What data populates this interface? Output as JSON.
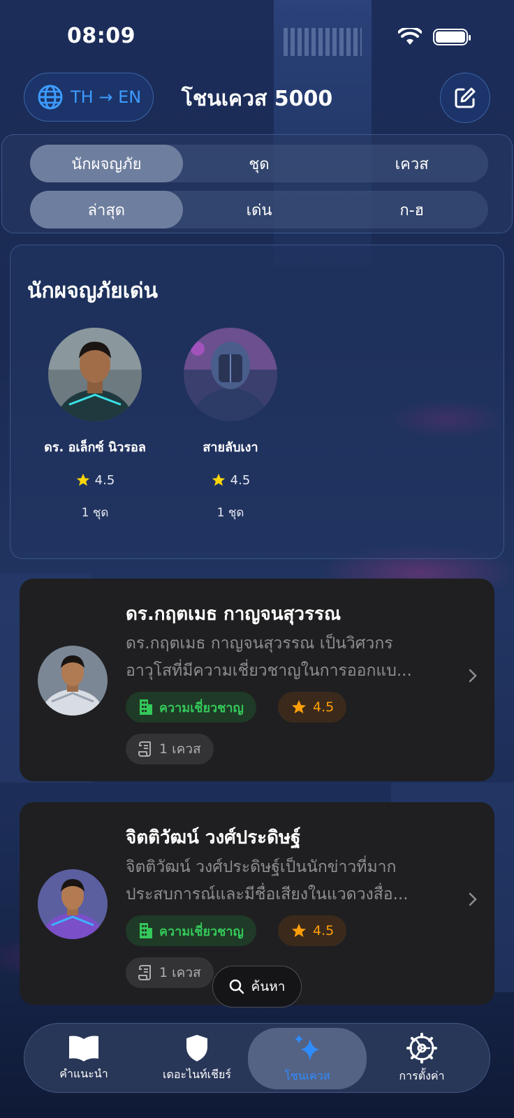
{
  "status_bar": {
    "time": "08:09"
  },
  "header": {
    "lang_label": "TH → EN",
    "title": "โชนเควส 5000"
  },
  "filters": {
    "row1": [
      "นักผจญภัย",
      "ชุด",
      "เควส"
    ],
    "row1_active": 0,
    "row2": [
      "ล่าสุด",
      "เด่น",
      "ก-ฮ"
    ],
    "row2_active": 0
  },
  "featured": {
    "title": "นักผจญภัยเด่น",
    "items": [
      {
        "name": "ดร. อเล็กซ์ นิวรอล",
        "rating": "4.5",
        "sets": "1 ชุด"
      },
      {
        "name": "สายลับเงา",
        "rating": "4.5",
        "sets": "1 ชุด"
      }
    ]
  },
  "list": [
    {
      "name": "ดร.กฤตเมธ กาญจนสุวรรณ",
      "desc_line1": "ดร.กฤตเมธ กาญจนสุวรรณ เป็นวิศวกร",
      "desc_line2": "อาวุโสที่มีความเชี่ยวชาญในการออกแบ...",
      "expertise": "ความเชี่ยวชาญ",
      "rating": "4.5",
      "quests": "1 เควส"
    },
    {
      "name": "จิตติวัฒน์ วงศ์ประดิษฐ์",
      "desc_line1": "จิตติวัฒน์ วงศ์ประดิษฐ์เป็นนักข่าวที่มาก",
      "desc_line2": "ประสบการณ์และมีชื่อเสียงในแวดวงสื่อ...",
      "expertise": "ความเชี่ยวชาญ",
      "rating": "4.5",
      "quests": "1 เควส"
    }
  ],
  "search": {
    "label": "ค้นหา"
  },
  "tabbar": {
    "items": [
      "คำแนะนำ",
      "เดอะไนท์เชียร์",
      "โชนเควส",
      "การตั้งค่า"
    ],
    "active": 2
  },
  "colors": {
    "accent": "#2f8cff",
    "expertise_green": "#34c759",
    "rating_orange": "#ff9f0a",
    "star_yellow": "#ffd60a"
  }
}
